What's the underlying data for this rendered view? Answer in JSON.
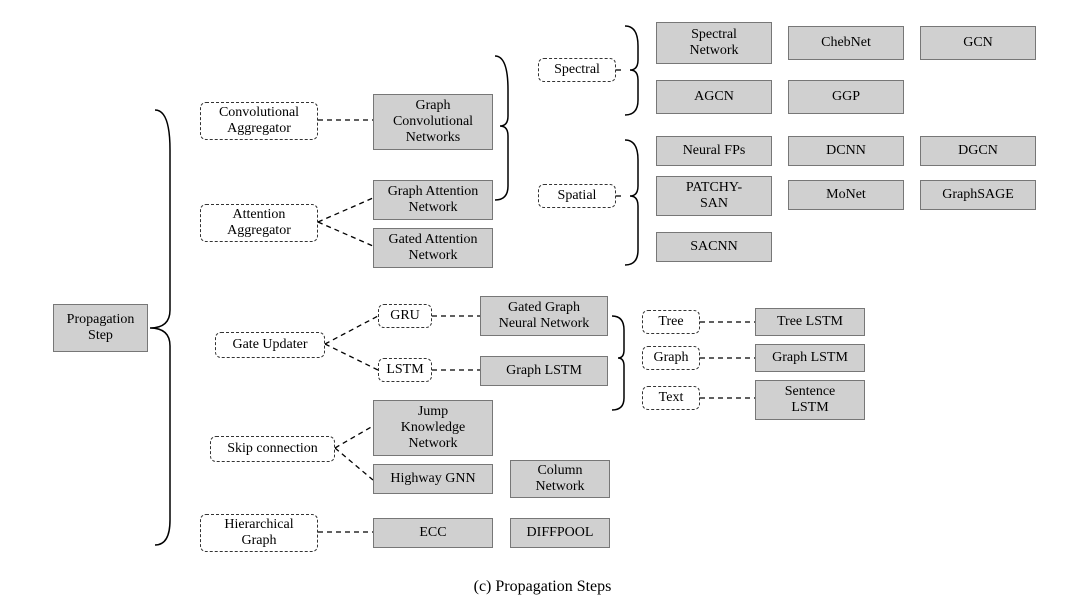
{
  "caption": "(c) Propagation Steps",
  "root": {
    "label": "Propagation\nStep"
  },
  "level1": {
    "conv_agg": "Convolutional\nAggregator",
    "attn_agg": "Attention\nAggregator",
    "gate_updater": "Gate Updater",
    "skip": "Skip connection",
    "hier": "Hierarchical\nGraph"
  },
  "level2": {
    "gcn_group": "Graph\nConvolutional\nNetworks",
    "gan": "Graph Attention\nNetwork",
    "gated_attn": "Gated Attention\nNetwork",
    "gru": "GRU",
    "lstm": "LSTM",
    "jkn": "Jump\nKnowledge\nNetwork",
    "hwy": "Highway GNN",
    "ecc": "ECC"
  },
  "level3": {
    "spectral_label": "Spectral",
    "spatial_label": "Spatial",
    "ggnn": "Gated Graph\nNeural Network",
    "graph_lstm_mid": "Graph LSTM",
    "column_net": "Column\nNetwork",
    "diffpool": "DIFFPOOL"
  },
  "lstm_kinds": {
    "tree": "Tree",
    "graph": "Graph",
    "text": "Text",
    "tree_lstm": "Tree LSTM",
    "graph_lstm": "Graph LSTM",
    "sentence_lstm": "Sentence\nLSTM"
  },
  "spectral_methods": {
    "spectral_net": "Spectral\nNetwork",
    "chebnet": "ChebNet",
    "gcn": "GCN",
    "agcn": "AGCN",
    "ggp": "GGP"
  },
  "spatial_methods": {
    "neural_fps": "Neural FPs",
    "dcnn": "DCNN",
    "dgcn": "DGCN",
    "patchy_san": "PATCHY-\nSAN",
    "monet": "MoNet",
    "graphsage": "GraphSAGE",
    "sacnn": "SACNN"
  }
}
